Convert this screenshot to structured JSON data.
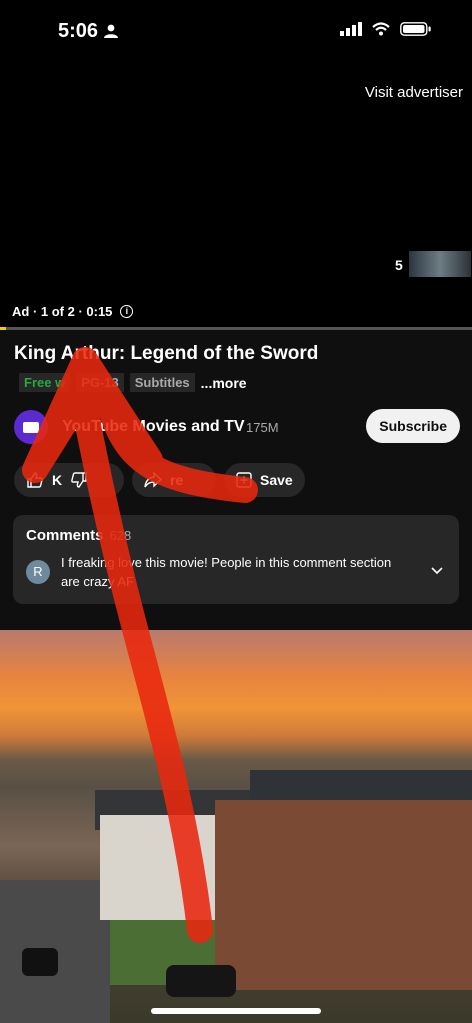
{
  "status_bar": {
    "time": "5:06"
  },
  "ad": {
    "visit_advertiser": "Visit advertiser",
    "countdown": "5",
    "info": "Ad · 1 of 2 · 0:15",
    "progress": 0.0
  },
  "video": {
    "title": "King Arthur: Legend of the Sword",
    "tags": [
      "Free w",
      "PG-13",
      "Subtitles"
    ],
    "more": "...more"
  },
  "channel": {
    "name": "YouTube Movies and TV",
    "subscribers": "175M",
    "subscribe_label": "Subscribe"
  },
  "actions": {
    "like_label": "K",
    "share_label": "re",
    "save_label": "Save"
  },
  "comments": {
    "title": "Comments",
    "count": "628",
    "avatar_letter": "R",
    "top_comment": "I freaking love this movie! People in this comment section are crazy AF"
  },
  "colors": {
    "accent": "#f5c518",
    "annotation_arrow": "#e8280f",
    "free_tag": "#2ba640"
  }
}
